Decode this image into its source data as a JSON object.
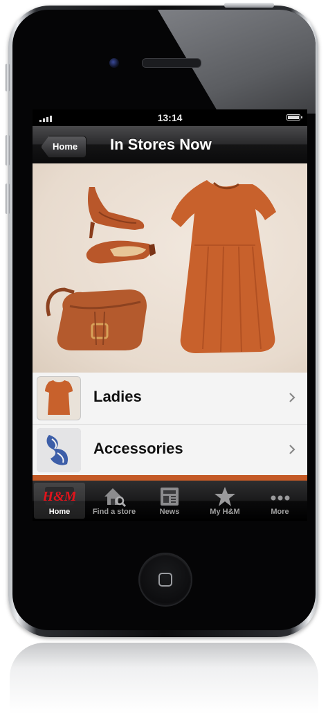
{
  "status_bar": {
    "time": "13:14"
  },
  "nav": {
    "back_label": "Home",
    "title": "In Stores Now"
  },
  "list": {
    "items": [
      {
        "label": "Ladies"
      },
      {
        "label": "Accessories"
      }
    ]
  },
  "tab_bar": {
    "tabs": [
      {
        "label": "Home",
        "icon": "hm-logo-icon",
        "active": true
      },
      {
        "label": "Find a store",
        "icon": "store-search-icon",
        "active": false
      },
      {
        "label": "News",
        "icon": "newspaper-icon",
        "active": false
      },
      {
        "label": "My H&M",
        "icon": "star-icon",
        "active": false
      },
      {
        "label": "More",
        "icon": "more-dots-icon",
        "active": false
      }
    ]
  },
  "colors": {
    "accent": "#c45a26",
    "brand_red": "#d9151b",
    "product_orange": "#c8612c"
  }
}
